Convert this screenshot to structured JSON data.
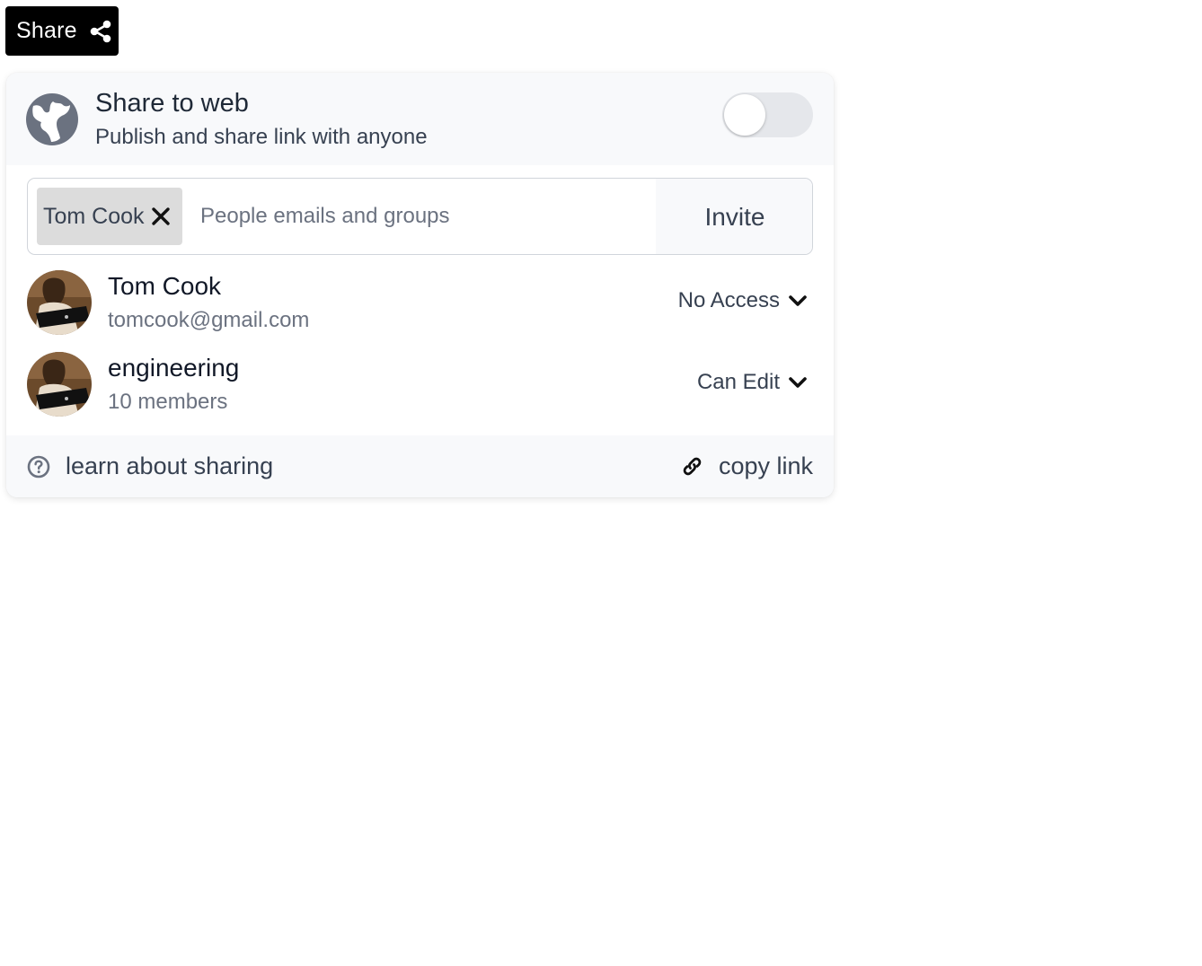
{
  "share_button": {
    "label": "Share",
    "icon": "share-icon"
  },
  "share_to_web": {
    "title": "Share to web",
    "subtitle": "Publish and share link with anyone",
    "icon": "globe-icon",
    "enabled": false
  },
  "invite": {
    "chips": [
      {
        "label": "Tom Cook"
      }
    ],
    "placeholder": "People emails and groups",
    "button_label": "Invite"
  },
  "members": [
    {
      "name": "Tom Cook",
      "detail": "tomcook@gmail.com",
      "permission": "No Access"
    },
    {
      "name": "engineering",
      "detail": "10 members",
      "permission": "Can Edit"
    }
  ],
  "footer": {
    "learn_label": "learn about sharing",
    "copy_label": "copy link"
  },
  "colors": {
    "share_button_bg": "#000000",
    "panel_section_bg": "#f8f9fb",
    "chip_bg": "#dcdcdc",
    "toggle_off": "#e5e7eb",
    "icon_gray": "#6b7280"
  }
}
